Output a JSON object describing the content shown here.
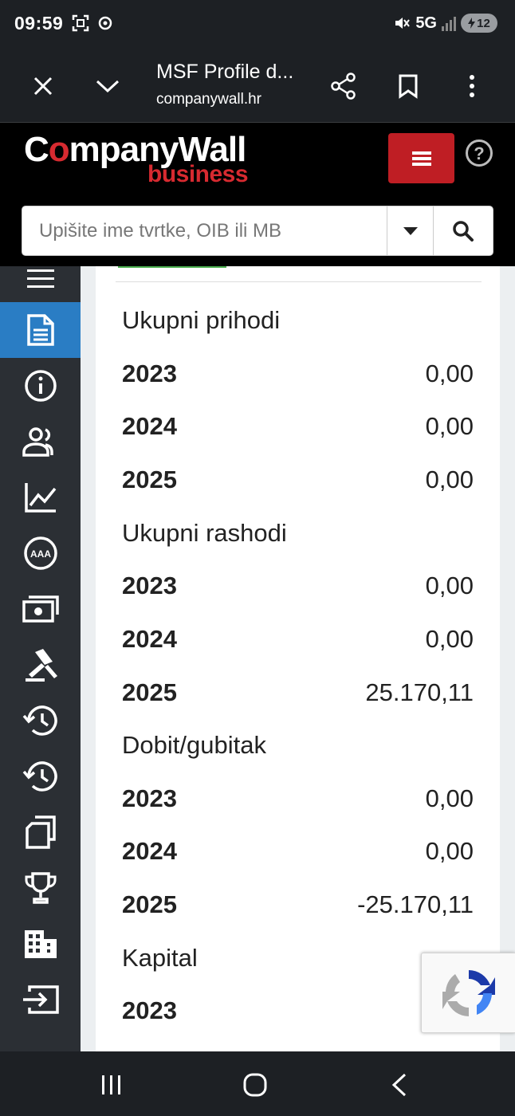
{
  "status_bar": {
    "time": "09:59",
    "network": "5G",
    "battery": "12",
    "icons": [
      "screenshot-icon",
      "sync-icon",
      "mute-icon",
      "signal-icon",
      "battery-icon"
    ]
  },
  "browser": {
    "tab_title": "MSF Profile d...",
    "url": "companywall.hr",
    "icons": [
      "close-icon",
      "chevron-down-icon",
      "share-icon",
      "bookmark-icon",
      "more-vert-icon"
    ]
  },
  "site": {
    "logo_main_1": "C",
    "logo_main_o": "o",
    "logo_main_2": "mpanyWall",
    "logo_sub": "business",
    "search_placeholder": "Upišite ime tvrtke, OIB ili MB"
  },
  "sidebar": {
    "icons": [
      "hamburger-icon",
      "document-icon",
      "info-icon",
      "people-icon",
      "chart-icon",
      "rating-aaa-icon",
      "money-icon",
      "gavel-icon",
      "history-icon",
      "history-icon-2",
      "copy-icon",
      "trophy-icon",
      "building-icon",
      "login-icon"
    ],
    "active_index": 1
  },
  "financials": [
    {
      "title": "Ukupni prihodi",
      "rows": [
        {
          "year": "2023",
          "value": "0,00"
        },
        {
          "year": "2024",
          "value": "0,00"
        },
        {
          "year": "2025",
          "value": "0,00"
        }
      ]
    },
    {
      "title": "Ukupni rashodi",
      "rows": [
        {
          "year": "2023",
          "value": "0,00"
        },
        {
          "year": "2024",
          "value": "0,00"
        },
        {
          "year": "2025",
          "value": "25.170,11"
        }
      ]
    },
    {
      "title": "Dobit/gubitak",
      "rows": [
        {
          "year": "2023",
          "value": "0,00"
        },
        {
          "year": "2024",
          "value": "0,00"
        },
        {
          "year": "2025",
          "value": "-25.170,11"
        }
      ]
    },
    {
      "title": "Kapital",
      "rows": [
        {
          "year": "2023",
          "value": ""
        }
      ]
    }
  ],
  "colors": {
    "brand_red": "#bf1e24",
    "active_blue": "#2a7dc4",
    "sidebar_bg": "#2b2f34"
  }
}
